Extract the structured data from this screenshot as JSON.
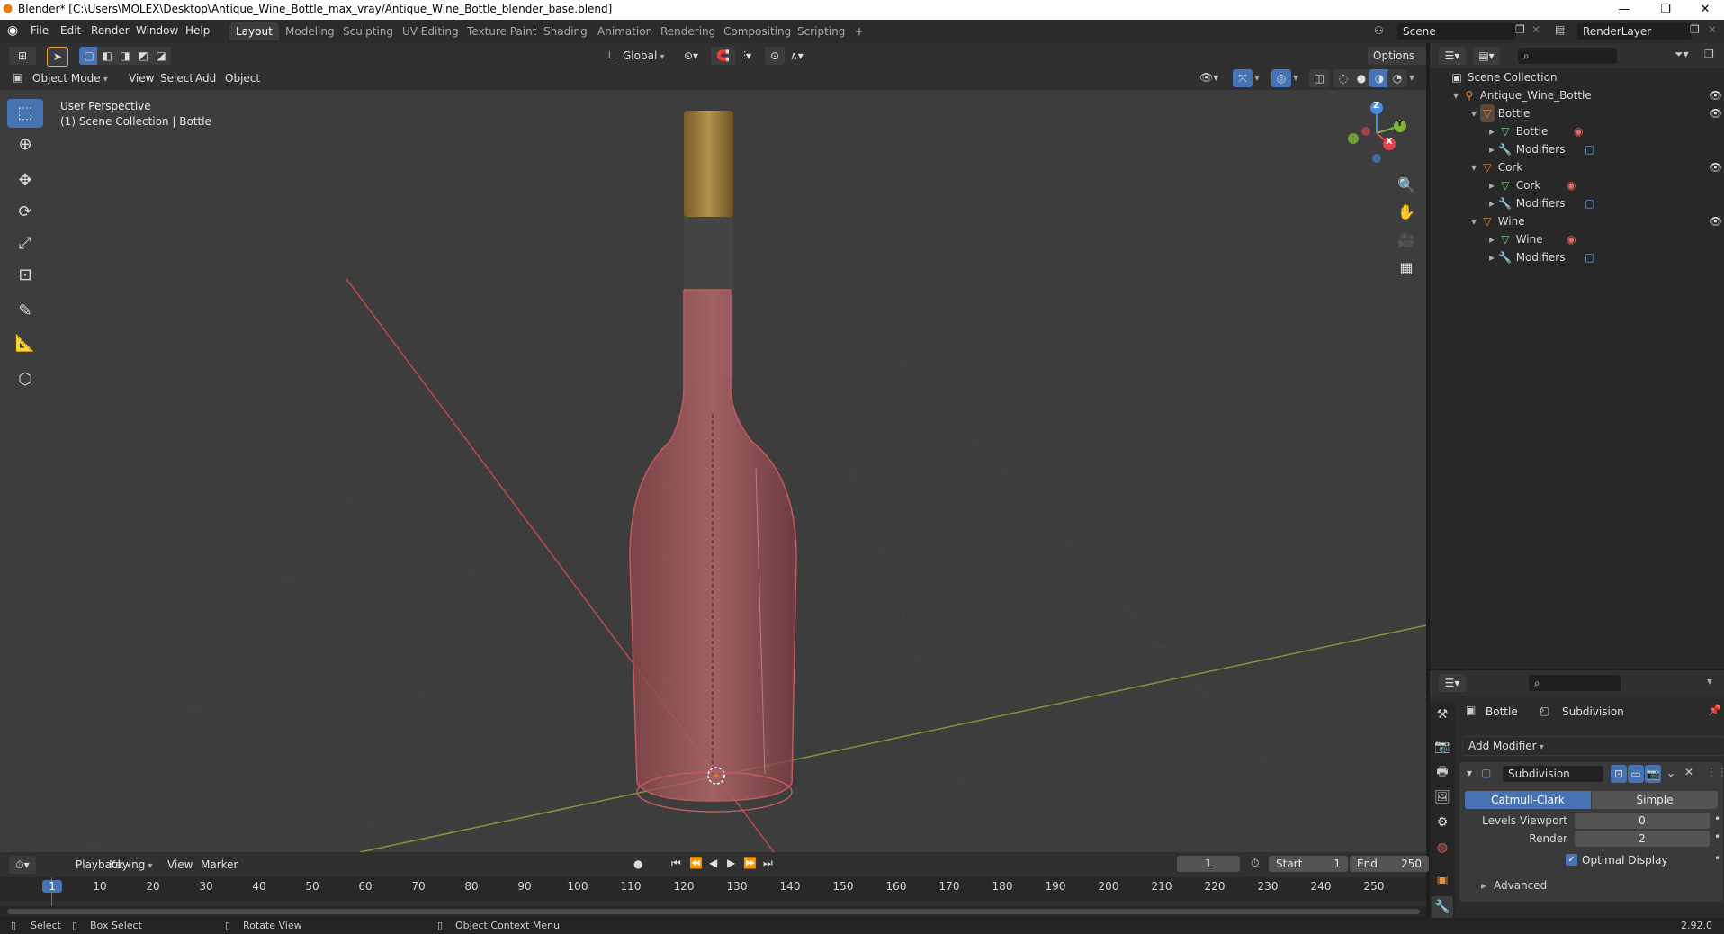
{
  "window": {
    "title": "Blender* [C:\\Users\\MOLEX\\Desktop\\Antique_Wine_Bottle_max_vray/Antique_Wine_Bottle_blender_base.blend]",
    "minimize": "—",
    "maximize": "❐",
    "close": "✕"
  },
  "menu": [
    "File",
    "Edit",
    "Render",
    "Window",
    "Help"
  ],
  "workspaces": [
    "Layout",
    "Modeling",
    "Sculpting",
    "UV Editing",
    "Texture Paint",
    "Shading",
    "Animation",
    "Rendering",
    "Compositing",
    "Scripting"
  ],
  "workspace_add": "+",
  "scene": {
    "name": "Scene",
    "render_layer": "RenderLayer"
  },
  "header": {
    "orientation": "Global",
    "options": "Options",
    "mode": "Object Mode",
    "view": "View",
    "select": "Select",
    "add": "Add",
    "object": "Object"
  },
  "viewport": {
    "perspective": "User Perspective",
    "collection_info": "(1) Scene Collection | Bottle",
    "gizmo_axes": {
      "x": "X",
      "y": "Y",
      "z": "Z"
    }
  },
  "outliner": {
    "root": "Scene Collection",
    "collection": "Antique_Wine_Bottle",
    "objects": [
      {
        "name": "Bottle",
        "mesh": "Bottle",
        "modifiers": "Modifiers"
      },
      {
        "name": "Cork",
        "mesh": "Cork",
        "modifiers": "Modifiers"
      },
      {
        "name": "Wine",
        "mesh": "Wine",
        "modifiers": "Modifiers"
      }
    ]
  },
  "properties": {
    "object": "Bottle",
    "modifier_context": "Subdivision",
    "add_modifier": "Add Modifier",
    "modifier_name": "Subdivision",
    "mode_catmull": "Catmull-Clark",
    "mode_simple": "Simple",
    "levels_viewport_label": "Levels Viewport",
    "levels_viewport": "0",
    "render_label": "Render",
    "render": "2",
    "optimal_display": "Optimal Display",
    "advanced": "Advanced"
  },
  "timeline": {
    "playback": "Playback",
    "keying": "Keying",
    "view": "View",
    "marker": "Marker",
    "current_frame": "1",
    "start_label": "Start",
    "start": "1",
    "end_label": "End",
    "end": "250",
    "ruler": [
      "1",
      "10",
      "20",
      "30",
      "40",
      "50",
      "60",
      "70",
      "80",
      "90",
      "100",
      "110",
      "120",
      "130",
      "140",
      "150",
      "160",
      "170",
      "180",
      "190",
      "200",
      "210",
      "220",
      "230",
      "240",
      "250"
    ]
  },
  "status": {
    "select": "Select",
    "box_select": "Box Select",
    "rotate_view": "Rotate View",
    "context_menu": "Object Context Menu",
    "version": "2.92.0"
  },
  "colors": {
    "accent": "#4772b3",
    "orange": "#e88d3a",
    "mesh_green": "#7fd38a",
    "modifier_blue": "#6fa3e8"
  }
}
